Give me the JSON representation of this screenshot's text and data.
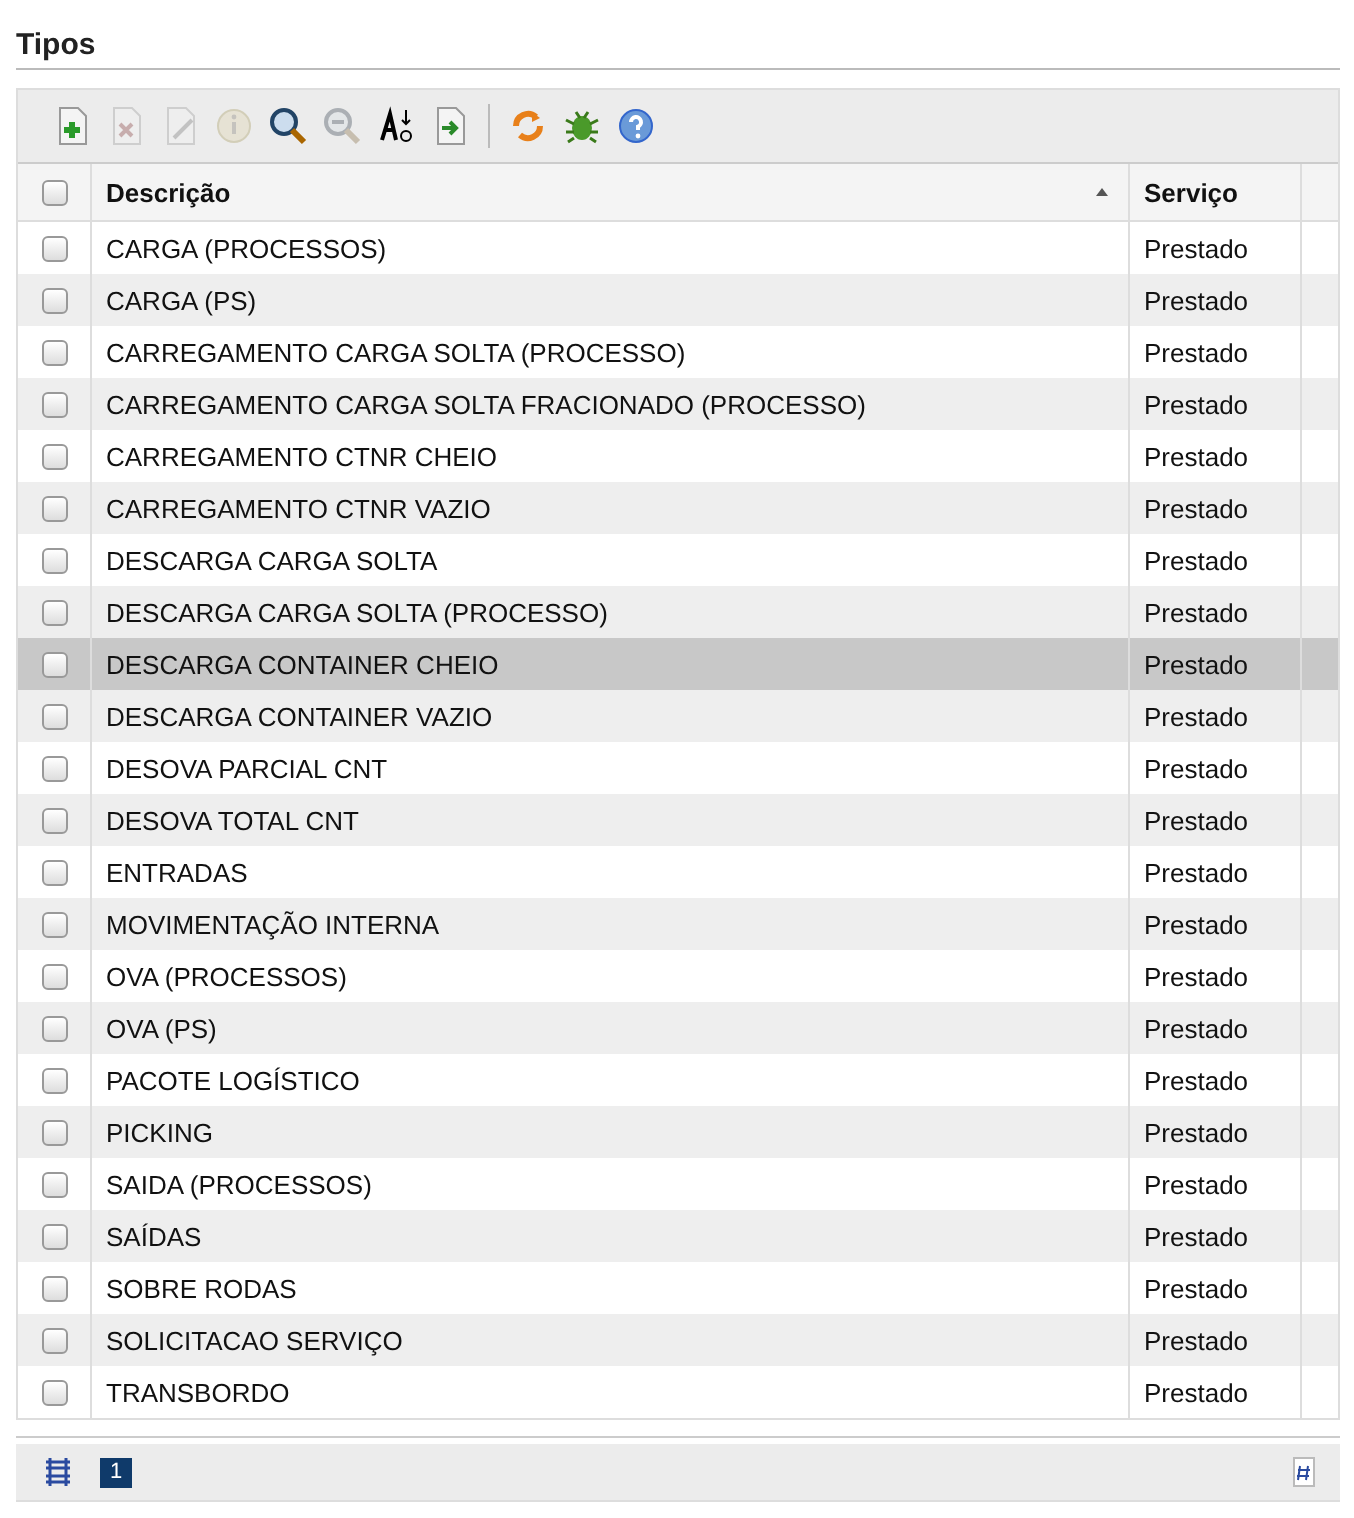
{
  "title": "Tipos",
  "toolbar": [
    {
      "kind": "add",
      "disabled": false
    },
    {
      "kind": "delete",
      "disabled": true
    },
    {
      "kind": "edit",
      "disabled": true
    },
    {
      "kind": "info",
      "disabled": true
    },
    {
      "kind": "search",
      "disabled": false
    },
    {
      "kind": "zoom-out",
      "disabled": true
    },
    {
      "kind": "sort",
      "disabled": false
    },
    {
      "kind": "export",
      "disabled": false
    },
    {
      "kind": "separator"
    },
    {
      "kind": "refresh",
      "disabled": false
    },
    {
      "kind": "bug",
      "disabled": false
    },
    {
      "kind": "help",
      "disabled": false
    }
  ],
  "table": {
    "header_checked": false,
    "columns": [
      {
        "label": "Descrição",
        "sorted": true
      },
      {
        "label": "Serviço",
        "sorted": false
      }
    ],
    "rows": [
      {
        "descricao": "CARGA (PROCESSOS)",
        "servico": "Prestado",
        "checked": false,
        "selected": false
      },
      {
        "descricao": "CARGA (PS)",
        "servico": "Prestado",
        "checked": false,
        "selected": false
      },
      {
        "descricao": "CARREGAMENTO CARGA SOLTA (PROCESSO)",
        "servico": "Prestado",
        "checked": false,
        "selected": false
      },
      {
        "descricao": "CARREGAMENTO CARGA SOLTA FRACIONADO (PROCESSO)",
        "servico": "Prestado",
        "checked": false,
        "selected": false
      },
      {
        "descricao": "CARREGAMENTO CTNR CHEIO",
        "servico": "Prestado",
        "checked": false,
        "selected": false
      },
      {
        "descricao": "CARREGAMENTO CTNR VAZIO",
        "servico": "Prestado",
        "checked": false,
        "selected": false
      },
      {
        "descricao": "DESCARGA CARGA SOLTA",
        "servico": "Prestado",
        "checked": false,
        "selected": false
      },
      {
        "descricao": "DESCARGA CARGA SOLTA (PROCESSO)",
        "servico": "Prestado",
        "checked": false,
        "selected": false
      },
      {
        "descricao": "DESCARGA CONTAINER CHEIO",
        "servico": "Prestado",
        "checked": false,
        "selected": true
      },
      {
        "descricao": "DESCARGA CONTAINER VAZIO",
        "servico": "Prestado",
        "checked": false,
        "selected": false
      },
      {
        "descricao": "DESOVA PARCIAL CNT",
        "servico": "Prestado",
        "checked": false,
        "selected": false
      },
      {
        "descricao": "DESOVA TOTAL CNT",
        "servico": "Prestado",
        "checked": false,
        "selected": false
      },
      {
        "descricao": "ENTRADAS",
        "servico": "Prestado",
        "checked": false,
        "selected": false
      },
      {
        "descricao": "MOVIMENTAÇÃO INTERNA",
        "servico": "Prestado",
        "checked": false,
        "selected": false
      },
      {
        "descricao": "OVA (PROCESSOS)",
        "servico": "Prestado",
        "checked": false,
        "selected": false
      },
      {
        "descricao": "OVA (PS)",
        "servico": "Prestado",
        "checked": false,
        "selected": false
      },
      {
        "descricao": "PACOTE LOGÍSTICO",
        "servico": "Prestado",
        "checked": false,
        "selected": false
      },
      {
        "descricao": "PICKING",
        "servico": "Prestado",
        "checked": false,
        "selected": false
      },
      {
        "descricao": "SAIDA (PROCESSOS)",
        "servico": "Prestado",
        "checked": false,
        "selected": false
      },
      {
        "descricao": "SAÍDAS",
        "servico": "Prestado",
        "checked": false,
        "selected": false
      },
      {
        "descricao": "SOBRE RODAS",
        "servico": "Prestado",
        "checked": false,
        "selected": false
      },
      {
        "descricao": "SOLICITACAO SERVIÇO",
        "servico": "Prestado",
        "checked": false,
        "selected": false
      },
      {
        "descricao": "TRANSBORDO",
        "servico": "Prestado",
        "checked": false,
        "selected": false
      }
    ]
  },
  "pager": {
    "pages": [
      {
        "label": "1",
        "selected": true
      }
    ]
  }
}
